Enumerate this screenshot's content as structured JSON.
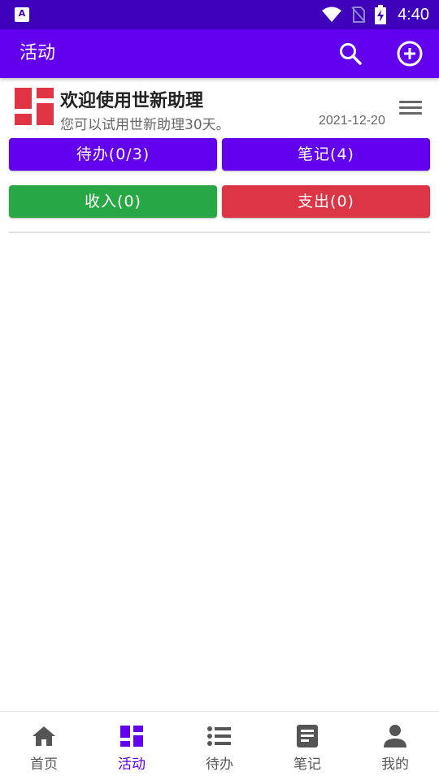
{
  "status_bar": {
    "left_icon": "A",
    "time": "4:40"
  },
  "app_bar": {
    "title": "活动",
    "search_icon": "search-icon",
    "add_icon": "add-circle-icon"
  },
  "welcome": {
    "title": "欢迎使用世新助理",
    "subtitle": "您可以试用世新助理30天。",
    "date": "2021-12-20"
  },
  "buttons": {
    "todo": "待办(0/3)",
    "note": "笔记(4)",
    "income": "收入(0)",
    "expense": "支出(0)"
  },
  "bottom_nav": {
    "items": [
      {
        "label": "首页",
        "icon": "home-icon"
      },
      {
        "label": "活动",
        "icon": "dashboard-icon",
        "active": true
      },
      {
        "label": "待办",
        "icon": "list-icon"
      },
      {
        "label": "笔记",
        "icon": "note-icon"
      },
      {
        "label": "我的",
        "icon": "person-icon"
      }
    ]
  },
  "colors": {
    "status_bar": "#3e00b8",
    "primary": "#6200ee",
    "income": "#28a745",
    "expense": "#dc3545",
    "logo": "#e03444"
  }
}
